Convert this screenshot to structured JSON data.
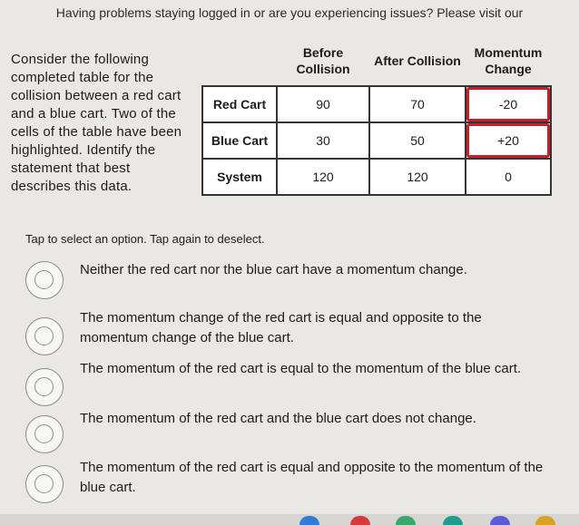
{
  "banner": "Having problems staying logged in or are you experiencing issues? Please visit our",
  "question": "Consider the following completed table for the collision between a red cart and a blue cart. Two of the cells of the table have been highlighted. Identify the statement that best describes this data.",
  "table": {
    "headers": [
      "",
      "Before Collision",
      "After Collision",
      "Momentum Change"
    ],
    "rows": [
      {
        "label": "Red Cart",
        "cells": [
          "90",
          "70",
          "-20"
        ]
      },
      {
        "label": "Blue Cart",
        "cells": [
          "30",
          "50",
          "+20"
        ]
      },
      {
        "label": "System",
        "cells": [
          "120",
          "120",
          "0"
        ]
      }
    ],
    "highlight_color": "#c81e2a"
  },
  "instruction": "Tap to select an option. Tap again to deselect.",
  "options": [
    "Neither the red cart nor the blue cart have a momentum change.",
    "The momentum change of the red cart is equal and opposite to the momentum change of the blue cart.",
    "The momentum of the red cart is equal to the momentum of the blue cart.",
    "The momentum of the red cart and the blue cart does not change.",
    "The momentum of the red cart is equal and opposite to the momentum of the blue cart."
  ],
  "taskbar_colors": [
    "#2f7bd6",
    "#d63b3b",
    "#3aa76d",
    "#1f9c8e",
    "#5b5bd6",
    "#d9a126"
  ]
}
